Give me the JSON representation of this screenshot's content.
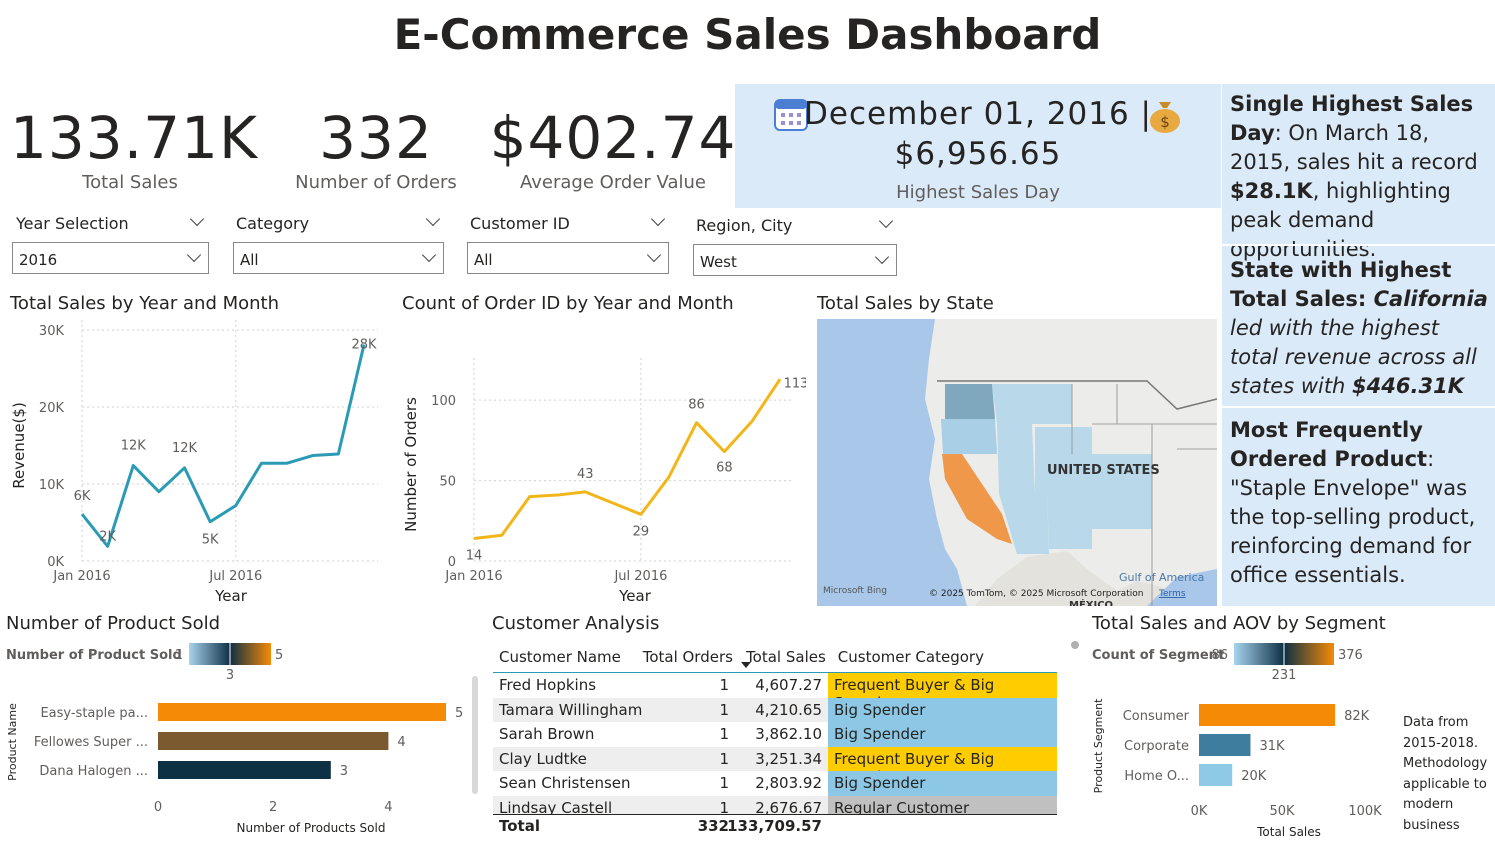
{
  "title": "E-Commerce Sales Dashboard",
  "kpis": [
    {
      "value": "133.71K",
      "label": "Total Sales"
    },
    {
      "value": "332",
      "label": "Number of Orders"
    },
    {
      "value": "$402.74",
      "label": "Average Order Value"
    }
  ],
  "highest_day": {
    "date": "December 01, 2016 |",
    "amount": "$6,956.65",
    "label": "Highest Sales Day",
    "calendar_icon": "calendar-icon",
    "money_icon": "money-bag-icon"
  },
  "insights": {
    "i1": {
      "head": "Single Highest Sales Day",
      "colon": ":",
      "body": " On March 18, 2015, sales hit a record ",
      "bold": "$28.1K",
      "tail": ", highlighting peak demand opportunities."
    },
    "i2": {
      "head": "State with Highest Total Sales: ",
      "state": "California",
      "body": " led with the highest total revenue across all states with ",
      "bold": "$446.31K"
    },
    "i3": {
      "head": "Most Frequently Ordered Product",
      "body": ": \"Staple Envelope\" was the top-selling product, reinforcing demand for office essentials."
    }
  },
  "slicers": [
    {
      "label": "Year Selection",
      "value": "2016"
    },
    {
      "label": "Category",
      "value": "All"
    },
    {
      "label": "Customer ID",
      "value": "All"
    },
    {
      "label": "Region, City",
      "value": "West"
    }
  ],
  "chart_data": [
    {
      "type": "line",
      "title": "Total Sales by Year and Month",
      "xlabel": "Year",
      "ylabel": "Revenue($)",
      "x": [
        "2016-01",
        "2016-02",
        "2016-03",
        "2016-04",
        "2016-05",
        "2016-06",
        "2016-07",
        "2016-08",
        "2016-09",
        "2016-10",
        "2016-11",
        "2016-12"
      ],
      "x_ticks": [
        "Jan 2016",
        "Jul 2016"
      ],
      "y_ticks": [
        "0K",
        "10K",
        "20K",
        "30K"
      ],
      "values": [
        6100,
        1900,
        12400,
        9000,
        12100,
        5100,
        7200,
        12700,
        12700,
        13700,
        13900,
        28100
      ],
      "data_labels": [
        "6K",
        "2K",
        "12K",
        "",
        "12K",
        "5K",
        "",
        "",
        "",
        "",
        "",
        "28K"
      ],
      "ylim": [
        0,
        30000
      ],
      "color": "#2b9bb5",
      "grid": true
    },
    {
      "type": "line",
      "title": "Count of Order ID by Year and Month",
      "xlabel": "Year",
      "ylabel": "Number of Orders",
      "x": [
        "2016-01",
        "2016-02",
        "2016-03",
        "2016-04",
        "2016-05",
        "2016-06",
        "2016-07",
        "2016-08",
        "2016-09",
        "2016-10",
        "2016-11",
        "2016-12"
      ],
      "x_ticks": [
        "Jan 2016",
        "Jul 2016"
      ],
      "y_ticks": [
        "0",
        "50",
        "100"
      ],
      "values": [
        14,
        16,
        40,
        41,
        43,
        36,
        29,
        52,
        86,
        68,
        87,
        113
      ],
      "data_labels": [
        "14",
        "",
        "",
        "",
        "43",
        "",
        "29",
        "",
        "86",
        "68",
        "",
        "113"
      ],
      "ylim": [
        0,
        120
      ],
      "color": "#f2b619",
      "grid": true
    },
    {
      "type": "map",
      "title": "Total Sales by State",
      "country_label": "UNITED STATES",
      "gulf_label": "Gulf of America",
      "mexico_label": "MÉXICO",
      "credit": "© 2025 TomTom, © 2025 Microsoft Corporation",
      "terms": "Terms",
      "bing": "Microsoft Bing",
      "highlight_color": "#f0984a",
      "base_color": "#b9d9ea"
    },
    {
      "type": "bar",
      "orientation": "horizontal",
      "title": "Number of Product Sold",
      "legend_title": "Number of Product Sold",
      "legend_min": "1",
      "legend_mid": "3",
      "legend_max": "5",
      "categories": [
        "Easy-staple pa...",
        "Fellowes Super ...",
        "Dana Halogen ..."
      ],
      "values": [
        5,
        4,
        3
      ],
      "data_labels": [
        "5",
        "4",
        "3"
      ],
      "colors": [
        "#f58a07",
        "#7b5a2f",
        "#0e3045"
      ],
      "xlabel": "Number of Products Sold",
      "ylabel": "Product Name",
      "x_ticks": [
        "0",
        "2",
        "4"
      ],
      "xlim": [
        0,
        5
      ]
    },
    {
      "type": "table",
      "title": "Customer Analysis",
      "columns": [
        "Customer Name",
        "Total Orders",
        "Total Sales",
        "Customer Category"
      ],
      "rows": [
        [
          "Fred Hopkins",
          "1",
          "4,607.27",
          "Frequent Buyer & Big Spender"
        ],
        [
          "Tamara Willingham",
          "1",
          "4,210.65",
          "Big Spender"
        ],
        [
          "Sarah Brown",
          "1",
          "3,862.10",
          "Big Spender"
        ],
        [
          "Clay Ludtke",
          "1",
          "3,251.34",
          "Frequent Buyer & Big Spender"
        ],
        [
          "Sean Christensen",
          "1",
          "2,803.92",
          "Big Spender"
        ],
        [
          "Lindsay Castell",
          "1",
          "2,676.67",
          "Regular Customer"
        ]
      ],
      "category_colors": {
        "Frequent Buyer & Big Spender": "#ffcc00",
        "Big Spender": "#8cc8e6",
        "Regular Customer": "#c0c0c0"
      },
      "total": [
        "Total",
        "332",
        "133,709.57",
        ""
      ]
    },
    {
      "type": "bar",
      "orientation": "horizontal",
      "title": "Total Sales and AOV by Segment",
      "legend_title": "Count of Segment",
      "legend_min": "86",
      "legend_mid": "231",
      "legend_max": "376",
      "categories": [
        "Consumer",
        "Corporate",
        "Home O..."
      ],
      "values": [
        82000,
        31000,
        20000
      ],
      "data_labels": [
        "82K",
        "31K",
        "20K"
      ],
      "colors": [
        "#f58a07",
        "#3e7d9e",
        "#8ec9e6"
      ],
      "xlabel": "Total Sales",
      "ylabel": "Product Segment",
      "x_ticks": [
        "0K",
        "50K",
        "100K"
      ],
      "xlim": [
        0,
        100000
      ]
    }
  ],
  "note": {
    "lines": [
      "Data from",
      "2015-2018.",
      "Methodology",
      "applicable to",
      "modern",
      "business"
    ]
  }
}
